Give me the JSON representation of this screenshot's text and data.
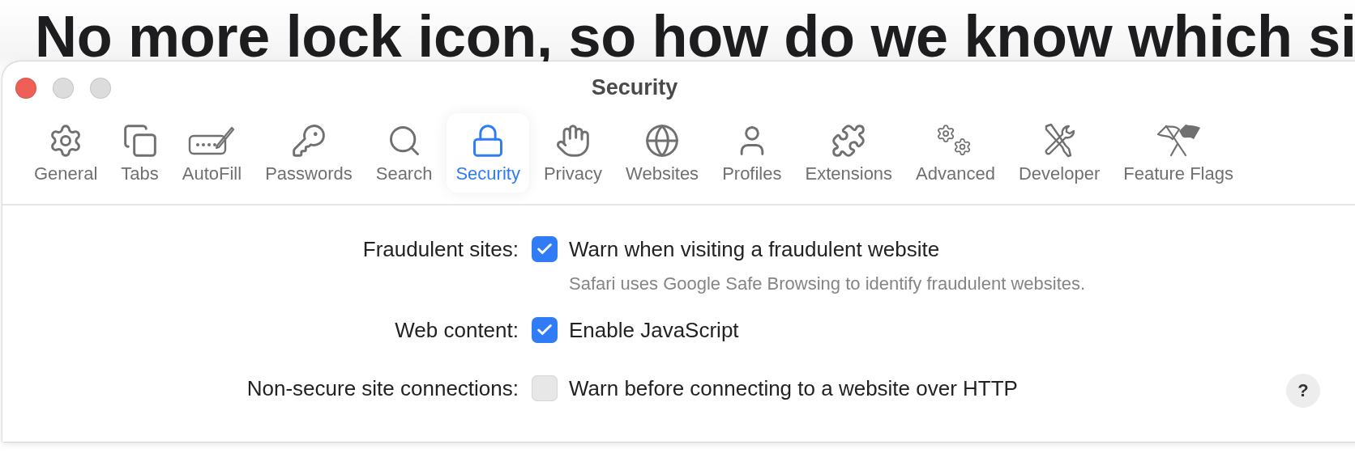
{
  "headline": "No more lock icon, so how do we know which si",
  "window": {
    "title": "Security"
  },
  "tabs": [
    {
      "label": "General",
      "selected": false
    },
    {
      "label": "Tabs",
      "selected": false
    },
    {
      "label": "AutoFill",
      "selected": false
    },
    {
      "label": "Passwords",
      "selected": false
    },
    {
      "label": "Search",
      "selected": false
    },
    {
      "label": "Security",
      "selected": true
    },
    {
      "label": "Privacy",
      "selected": false
    },
    {
      "label": "Websites",
      "selected": false
    },
    {
      "label": "Profiles",
      "selected": false
    },
    {
      "label": "Extensions",
      "selected": false
    },
    {
      "label": "Advanced",
      "selected": false
    },
    {
      "label": "Developer",
      "selected": false
    },
    {
      "label": "Feature Flags",
      "selected": false
    }
  ],
  "settings": [
    {
      "label": "Fraudulent sites:",
      "option": "Warn when visiting a fraudulent website",
      "checked": true,
      "note": "Safari uses Google Safe Browsing to identify fraudulent websites."
    },
    {
      "label": "Web content:",
      "option": "Enable JavaScript",
      "checked": true
    },
    {
      "label": "Non-secure site connections:",
      "option": "Warn before connecting to a website over HTTP",
      "checked": false
    }
  ],
  "help_button": "?"
}
